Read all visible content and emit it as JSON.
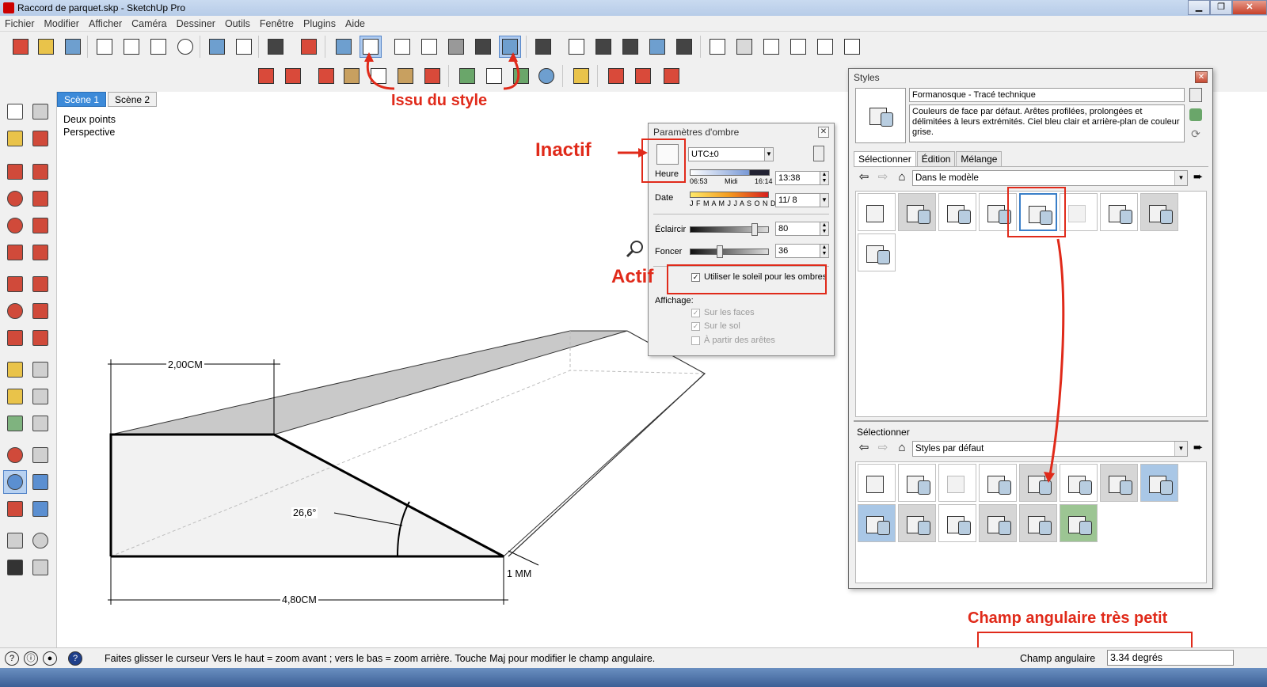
{
  "window": {
    "title": "Raccord de parquet.skp - SketchUp Pro",
    "minimize": "▁",
    "maximize": "❐",
    "close": "✕"
  },
  "menu": [
    "Fichier",
    "Modifier",
    "Afficher",
    "Caméra",
    "Dessiner",
    "Outils",
    "Fenêtre",
    "Plugins",
    "Aide"
  ],
  "scenes": [
    "Scène 1",
    "Scène 2"
  ],
  "viewport": {
    "camera_line1": "Deux points",
    "camera_line2": "Perspective",
    "dim_top": "2,00CM",
    "dim_angle": "26,6°",
    "dim_bottom": "4,80CM",
    "dim_right": "1 MM"
  },
  "shadow_panel": {
    "title": "Paramètres d'ombre",
    "heure_label": "Heure",
    "timezone": "UTC±0",
    "time_start": "06:53",
    "time_mid": "Midi",
    "time_end": "16:14",
    "time_value": "13:38",
    "date_label": "Date",
    "months": "J F M A M J J A S O N D",
    "date_value": "11/ 8",
    "eclaircir_label": "Éclaircir",
    "eclaircir_value": "80",
    "foncer_label": "Foncer",
    "foncer_value": "36",
    "use_sun_label": "Utiliser le soleil pour les ombres",
    "affichage_label": "Affichage:",
    "on_faces": "Sur les faces",
    "on_ground": "Sur le sol",
    "from_edges": "À partir des arêtes"
  },
  "styles_panel": {
    "title": "Styles",
    "style_name": "Formanosque - Tracé technique",
    "style_desc": "Couleurs de face par défaut. Arêtes profilées, prolongées et délimitées à leurs extrémités. Ciel bleu clair et arrière-plan de couleur grise.",
    "tabs": [
      "Sélectionner",
      "Édition",
      "Mélange"
    ],
    "top_collection": "Dans le modèle",
    "bottom_label": "Sélectionner",
    "bottom_collection": "Styles par défaut"
  },
  "statusbar": {
    "hint": "Faites glisser le curseur  Vers le haut = zoom avant ; vers le bas = zoom arrière. Touche Maj pour modifier le champ angulaire.",
    "vcb_label": "Champ angulaire",
    "vcb_value": "3.34 degrés"
  },
  "annotations": {
    "issu": "Issu du style",
    "inactif": "Inactif",
    "actif": "Actif",
    "champ": "Champ angulaire très petit"
  },
  "colors": {
    "annotation": "#e02a1a",
    "selection": "#3a7fc8"
  }
}
